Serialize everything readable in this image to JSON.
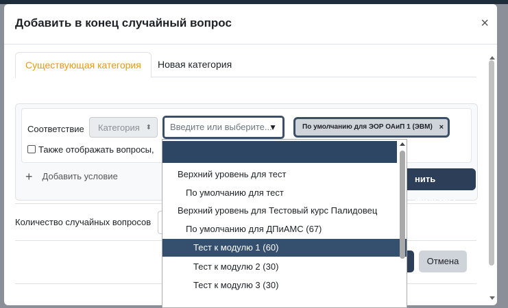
{
  "dialog": {
    "title": "Добавить в конец случайный вопрос",
    "close_symbol": "×"
  },
  "tabs": [
    {
      "label": "Существующая категория",
      "active": true
    },
    {
      "label": "Новая категория",
      "active": false
    }
  ],
  "filter": {
    "condition_label": "Соответствие",
    "category_select": "Категория",
    "search_placeholder": "Введите или выберите...",
    "tag_label": "По умолчанию для ЭОР ОАиП 1 (ЭВМ)",
    "tag_remove": "×",
    "also_show_label": "Также отображать вопросы,",
    "add_condition_label": "Добавить условие",
    "apply_button_label": "нить фильтры"
  },
  "random_count_label": "Количество случайных вопросов",
  "cancel_button_label": "Отмена",
  "dropdown_options": [
    {
      "label": "Верхний уровень для тест",
      "level": 0,
      "selected": false
    },
    {
      "label": "По умолчанию для тест",
      "level": 1,
      "selected": false
    },
    {
      "label": "Верхний уровень для Тестовый курс Палидовец",
      "level": 0,
      "selected": false
    },
    {
      "label": "По умолчанию для ДПиАМС (67)",
      "level": 1,
      "selected": false
    },
    {
      "label": "Тест к модулю 1 (60)",
      "level": 2,
      "selected": true
    },
    {
      "label": "Тест к модулю 2 (30)",
      "level": 2,
      "selected": false
    },
    {
      "label": "Тест к модулю 3 (30)",
      "level": 2,
      "selected": false
    }
  ],
  "colors": {
    "primary": "#2c3e58",
    "active_tab": "#e89a0c",
    "selected_option": "#34506e"
  }
}
